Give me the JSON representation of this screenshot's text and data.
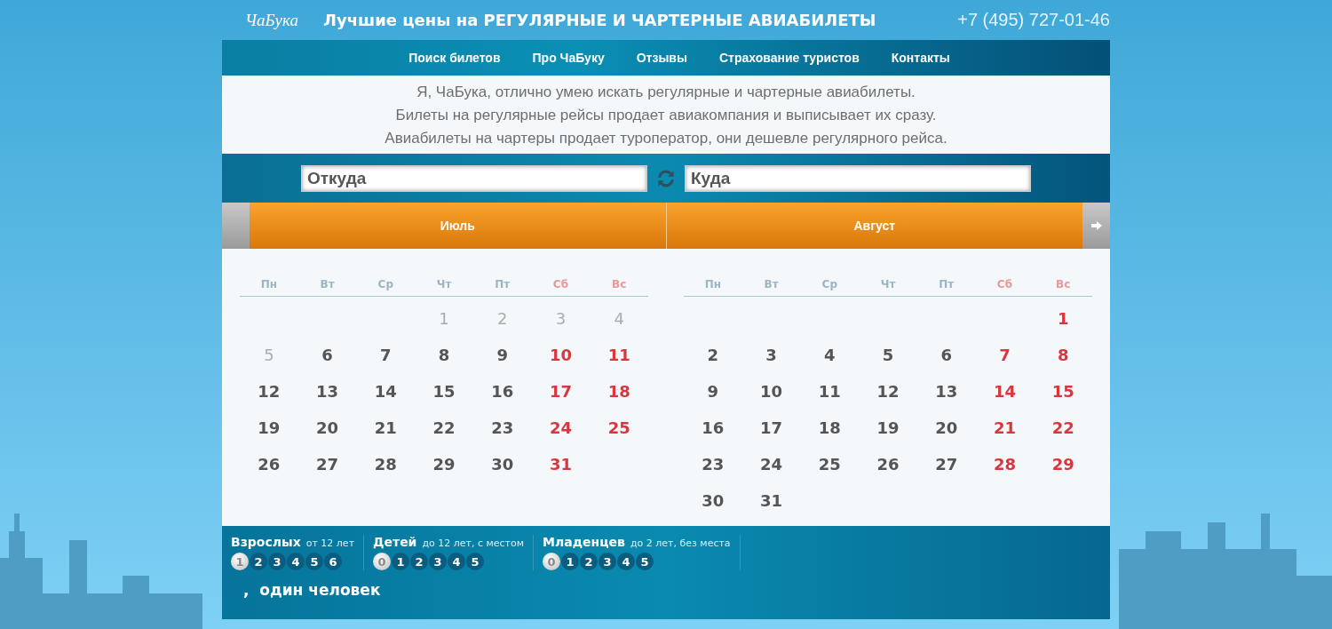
{
  "header": {
    "logo": "ЧаБука",
    "title": "Лучшие цены на РЕГУЛЯРНЫЕ И ЧАРТЕРНЫЕ АВИАБИЛЕТЫ",
    "phone": "+7 (495) 727-01-46"
  },
  "nav": [
    "Поиск билетов",
    "Про ЧаБуку",
    "Отзывы",
    "Страхование туристов",
    "Контакты"
  ],
  "intro": [
    "Я, ЧаБука, отлично умею искать регулярные и чартерные авиабилеты.",
    "Билеты на регулярные рейсы продает авиакомпания и выписывает их сразу.",
    "Авиабилеты на чартеры продает туроператор, они дешевле регулярного рейса."
  ],
  "search": {
    "from": {
      "placeholder": "Откуда"
    },
    "to": {
      "placeholder": "Куда"
    }
  },
  "months": [
    {
      "name": "Июль",
      "weekdays": [
        "Пн",
        "Вт",
        "Ср",
        "Чт",
        "Пт",
        "Сб",
        "Вс"
      ],
      "weeks": [
        [
          {
            "kind": "blank"
          },
          {
            "kind": "blank"
          },
          {
            "kind": "blank"
          },
          {
            "kind": "day",
            "day": "1",
            "disabled": true
          },
          {
            "kind": "day",
            "day": "2",
            "disabled": true
          },
          {
            "kind": "day",
            "day": "3",
            "disabled": true
          },
          {
            "kind": "day",
            "day": "4",
            "disabled": true
          }
        ],
        [
          {
            "kind": "day",
            "day": "5",
            "disabled": true
          },
          {
            "kind": "day",
            "day": "6",
            "disabled": false
          },
          {
            "kind": "day",
            "day": "7",
            "disabled": false
          },
          {
            "kind": "day",
            "day": "8",
            "disabled": false
          },
          {
            "kind": "day",
            "day": "9",
            "disabled": false
          },
          {
            "kind": "day",
            "day": "10",
            "disabled": false
          },
          {
            "kind": "day",
            "day": "11",
            "disabled": false
          }
        ],
        [
          {
            "kind": "day",
            "day": "12",
            "disabled": false
          },
          {
            "kind": "day",
            "day": "13",
            "disabled": false
          },
          {
            "kind": "day",
            "day": "14",
            "disabled": false
          },
          {
            "kind": "day",
            "day": "15",
            "disabled": false
          },
          {
            "kind": "day",
            "day": "16",
            "disabled": false
          },
          {
            "kind": "day",
            "day": "17",
            "disabled": false
          },
          {
            "kind": "day",
            "day": "18",
            "disabled": false
          }
        ],
        [
          {
            "kind": "day",
            "day": "19",
            "disabled": false
          },
          {
            "kind": "day",
            "day": "20",
            "disabled": false
          },
          {
            "kind": "day",
            "day": "21",
            "disabled": false
          },
          {
            "kind": "day",
            "day": "22",
            "disabled": false
          },
          {
            "kind": "day",
            "day": "23",
            "disabled": false
          },
          {
            "kind": "day",
            "day": "24",
            "disabled": false
          },
          {
            "kind": "day",
            "day": "25",
            "disabled": false
          }
        ],
        [
          {
            "kind": "day",
            "day": "26",
            "disabled": false
          },
          {
            "kind": "day",
            "day": "27",
            "disabled": false
          },
          {
            "kind": "day",
            "day": "28",
            "disabled": false
          },
          {
            "kind": "day",
            "day": "29",
            "disabled": false
          },
          {
            "kind": "day",
            "day": "30",
            "disabled": false
          },
          {
            "kind": "day",
            "day": "31",
            "disabled": false
          },
          {
            "kind": "blank"
          }
        ]
      ]
    },
    {
      "name": "Август",
      "weekdays": [
        "Пн",
        "Вт",
        "Ср",
        "Чт",
        "Пт",
        "Сб",
        "Вс"
      ],
      "weeks": [
        [
          {
            "kind": "blank"
          },
          {
            "kind": "blank"
          },
          {
            "kind": "blank"
          },
          {
            "kind": "blank"
          },
          {
            "kind": "blank"
          },
          {
            "kind": "blank"
          },
          {
            "kind": "day",
            "day": "1",
            "disabled": false
          }
        ],
        [
          {
            "kind": "day",
            "day": "2",
            "disabled": false
          },
          {
            "kind": "day",
            "day": "3",
            "disabled": false
          },
          {
            "kind": "day",
            "day": "4",
            "disabled": false
          },
          {
            "kind": "day",
            "day": "5",
            "disabled": false
          },
          {
            "kind": "day",
            "day": "6",
            "disabled": false
          },
          {
            "kind": "day",
            "day": "7",
            "disabled": false
          },
          {
            "kind": "day",
            "day": "8",
            "disabled": false
          }
        ],
        [
          {
            "kind": "day",
            "day": "9",
            "disabled": false
          },
          {
            "kind": "day",
            "day": "10",
            "disabled": false
          },
          {
            "kind": "day",
            "day": "11",
            "disabled": false
          },
          {
            "kind": "day",
            "day": "12",
            "disabled": false
          },
          {
            "kind": "day",
            "day": "13",
            "disabled": false
          },
          {
            "kind": "day",
            "day": "14",
            "disabled": false
          },
          {
            "kind": "day",
            "day": "15",
            "disabled": false
          }
        ],
        [
          {
            "kind": "day",
            "day": "16",
            "disabled": false
          },
          {
            "kind": "day",
            "day": "17",
            "disabled": false
          },
          {
            "kind": "day",
            "day": "18",
            "disabled": false
          },
          {
            "kind": "day",
            "day": "19",
            "disabled": false
          },
          {
            "kind": "day",
            "day": "20",
            "disabled": false
          },
          {
            "kind": "day",
            "day": "21",
            "disabled": false
          },
          {
            "kind": "day",
            "day": "22",
            "disabled": false
          }
        ],
        [
          {
            "kind": "day",
            "day": "23",
            "disabled": false
          },
          {
            "kind": "day",
            "day": "24",
            "disabled": false
          },
          {
            "kind": "day",
            "day": "25",
            "disabled": false
          },
          {
            "kind": "day",
            "day": "26",
            "disabled": false
          },
          {
            "kind": "day",
            "day": "27",
            "disabled": false
          },
          {
            "kind": "day",
            "day": "28",
            "disabled": false
          },
          {
            "kind": "day",
            "day": "29",
            "disabled": false
          }
        ],
        [
          {
            "kind": "day",
            "day": "30",
            "disabled": false
          },
          {
            "kind": "day",
            "day": "31",
            "disabled": false
          },
          {
            "kind": "blank"
          },
          {
            "kind": "blank"
          },
          {
            "kind": "blank"
          },
          {
            "kind": "blank"
          },
          {
            "kind": "blank"
          }
        ]
      ]
    }
  ],
  "passengers": [
    {
      "label": "Взрослых",
      "note": "от 12 лет",
      "options": [
        {
          "label": "1",
          "selected": true
        },
        {
          "label": "2",
          "selected": false
        },
        {
          "label": "3",
          "selected": false
        },
        {
          "label": "4",
          "selected": false
        },
        {
          "label": "5",
          "selected": false
        },
        {
          "label": "6",
          "selected": false
        }
      ]
    },
    {
      "label": "Детей",
      "note": "до 12 лет, с местом",
      "options": [
        {
          "label": "0",
          "selected": true
        },
        {
          "label": "1",
          "selected": false
        },
        {
          "label": "2",
          "selected": false
        },
        {
          "label": "3",
          "selected": false
        },
        {
          "label": "4",
          "selected": false
        },
        {
          "label": "5",
          "selected": false
        }
      ]
    },
    {
      "label": "Младенцев",
      "note": "до 2 лет, без места",
      "options": [
        {
          "label": "0",
          "selected": true
        },
        {
          "label": "1",
          "selected": false
        },
        {
          "label": "2",
          "selected": false
        },
        {
          "label": "3",
          "selected": false
        },
        {
          "label": "4",
          "selected": false
        },
        {
          "label": "5",
          "selected": false
        }
      ]
    }
  ],
  "summary": ",  один человек"
}
